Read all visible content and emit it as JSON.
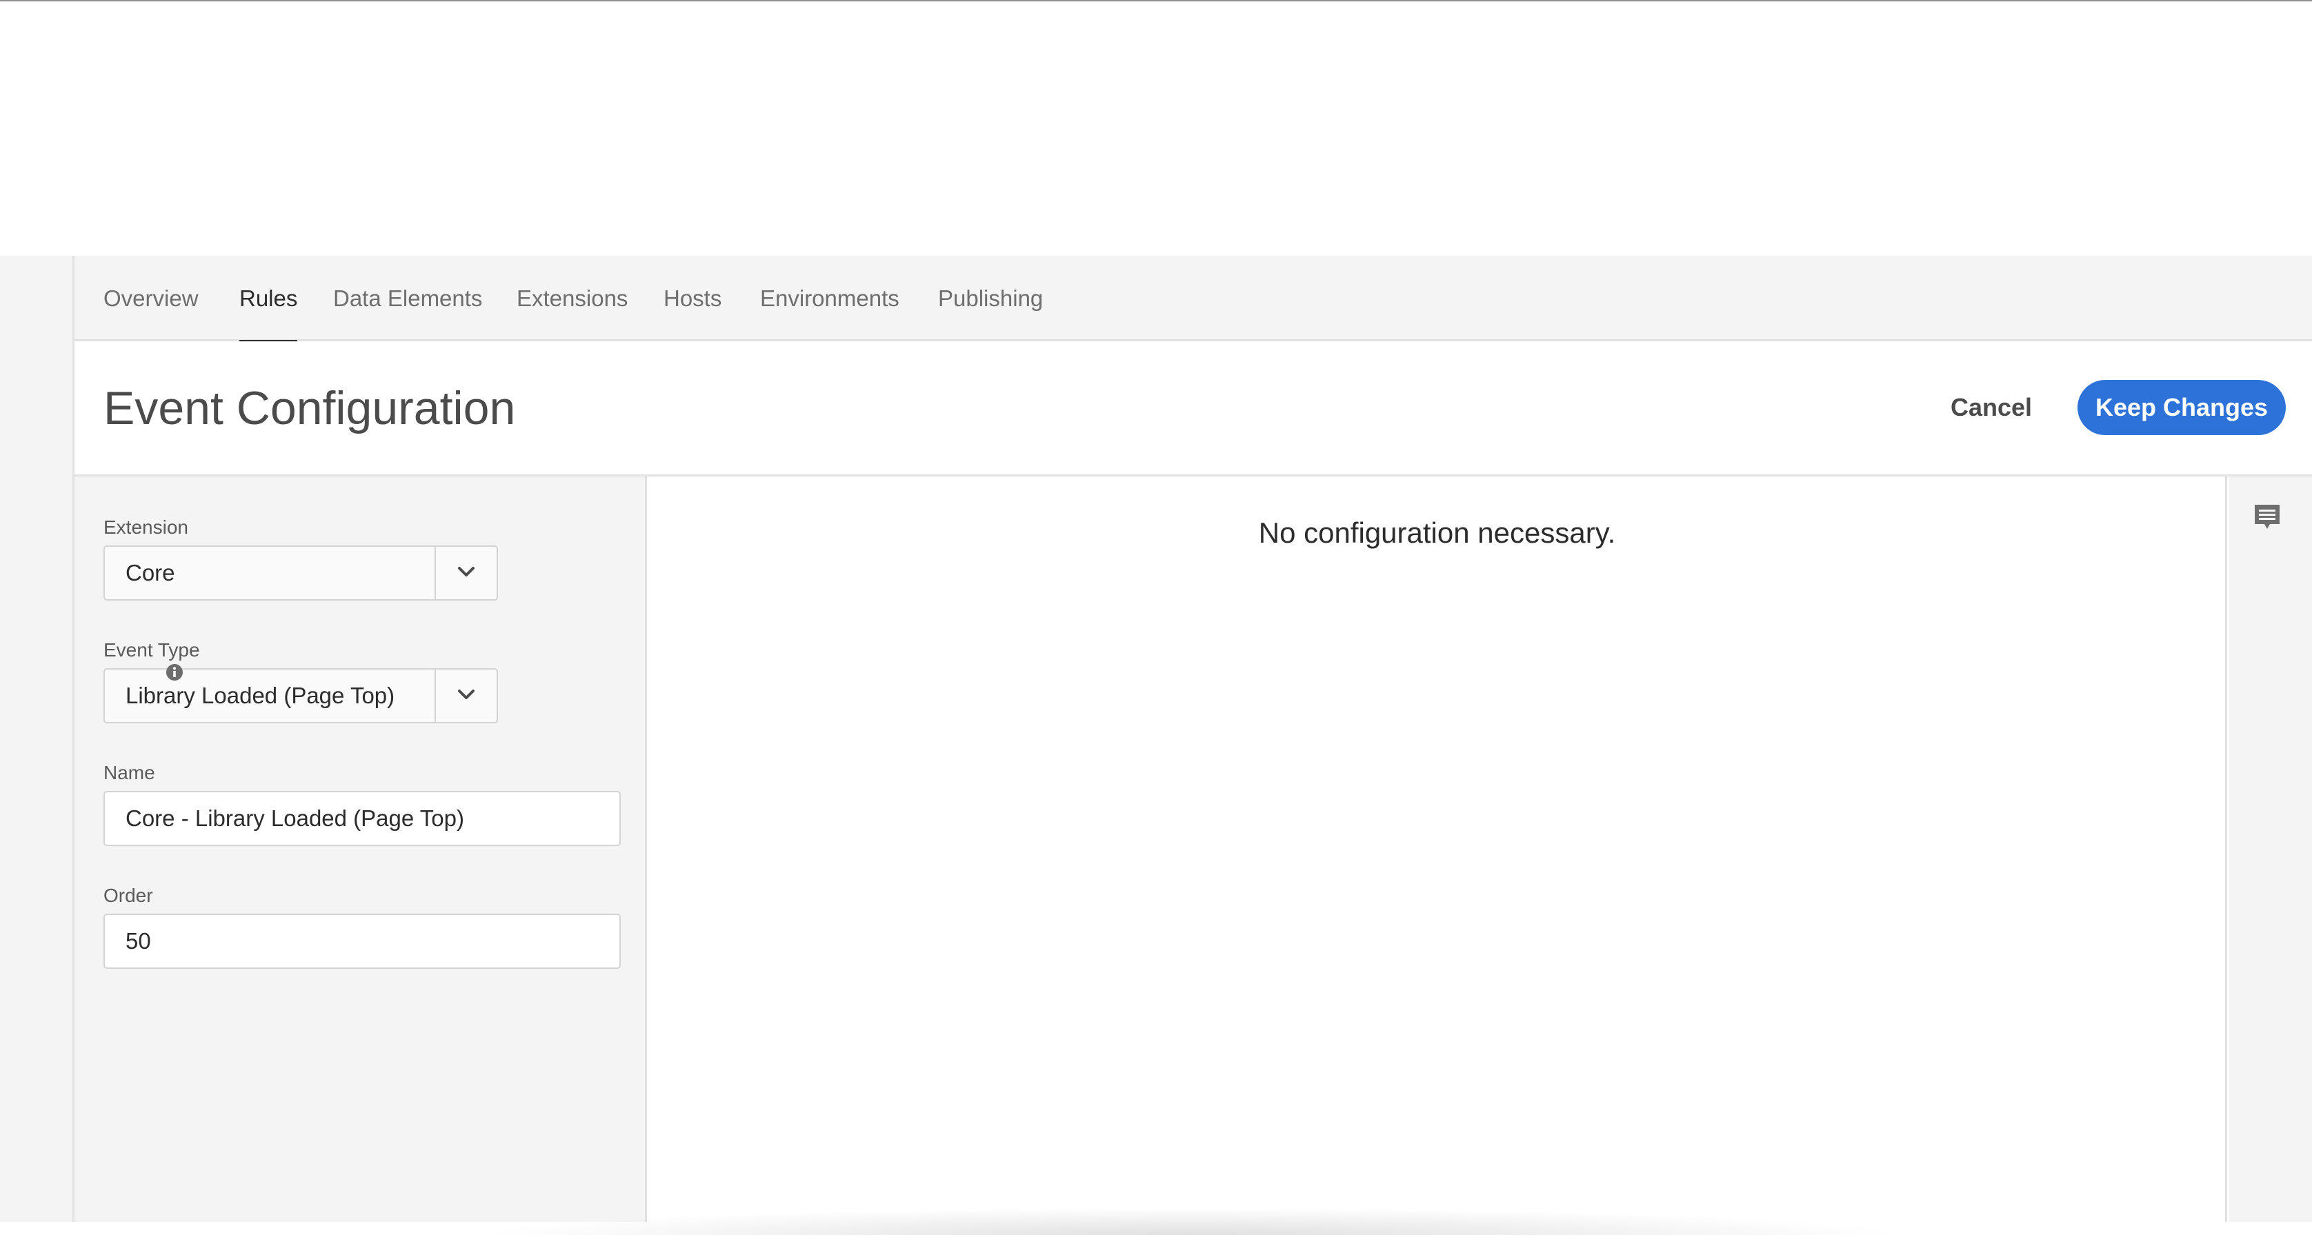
{
  "tabs": [
    {
      "label": "Overview"
    },
    {
      "label": "Rules"
    },
    {
      "label": "Data Elements"
    },
    {
      "label": "Extensions"
    },
    {
      "label": "Hosts"
    },
    {
      "label": "Environments"
    },
    {
      "label": "Publishing"
    }
  ],
  "active_tab": "Rules",
  "header": {
    "title": "Event Configuration",
    "cancel_label": "Cancel",
    "keep_label": "Keep Changes"
  },
  "colors": {
    "primary": "#2d72d9",
    "panel_bg": "#f4f4f4"
  },
  "form": {
    "extension": {
      "label": "Extension",
      "value": "Core"
    },
    "event_type": {
      "label": "Event Type",
      "value": "Library Loaded (Page Top)"
    },
    "name": {
      "label": "Name",
      "value": "Core - Library Loaded (Page Top)"
    },
    "order": {
      "label": "Order",
      "value": "50"
    }
  },
  "main": {
    "message": "No configuration necessary."
  },
  "icons": {
    "dropdown": "chevron-down-icon",
    "info": "info-icon",
    "comment": "comment-icon"
  }
}
